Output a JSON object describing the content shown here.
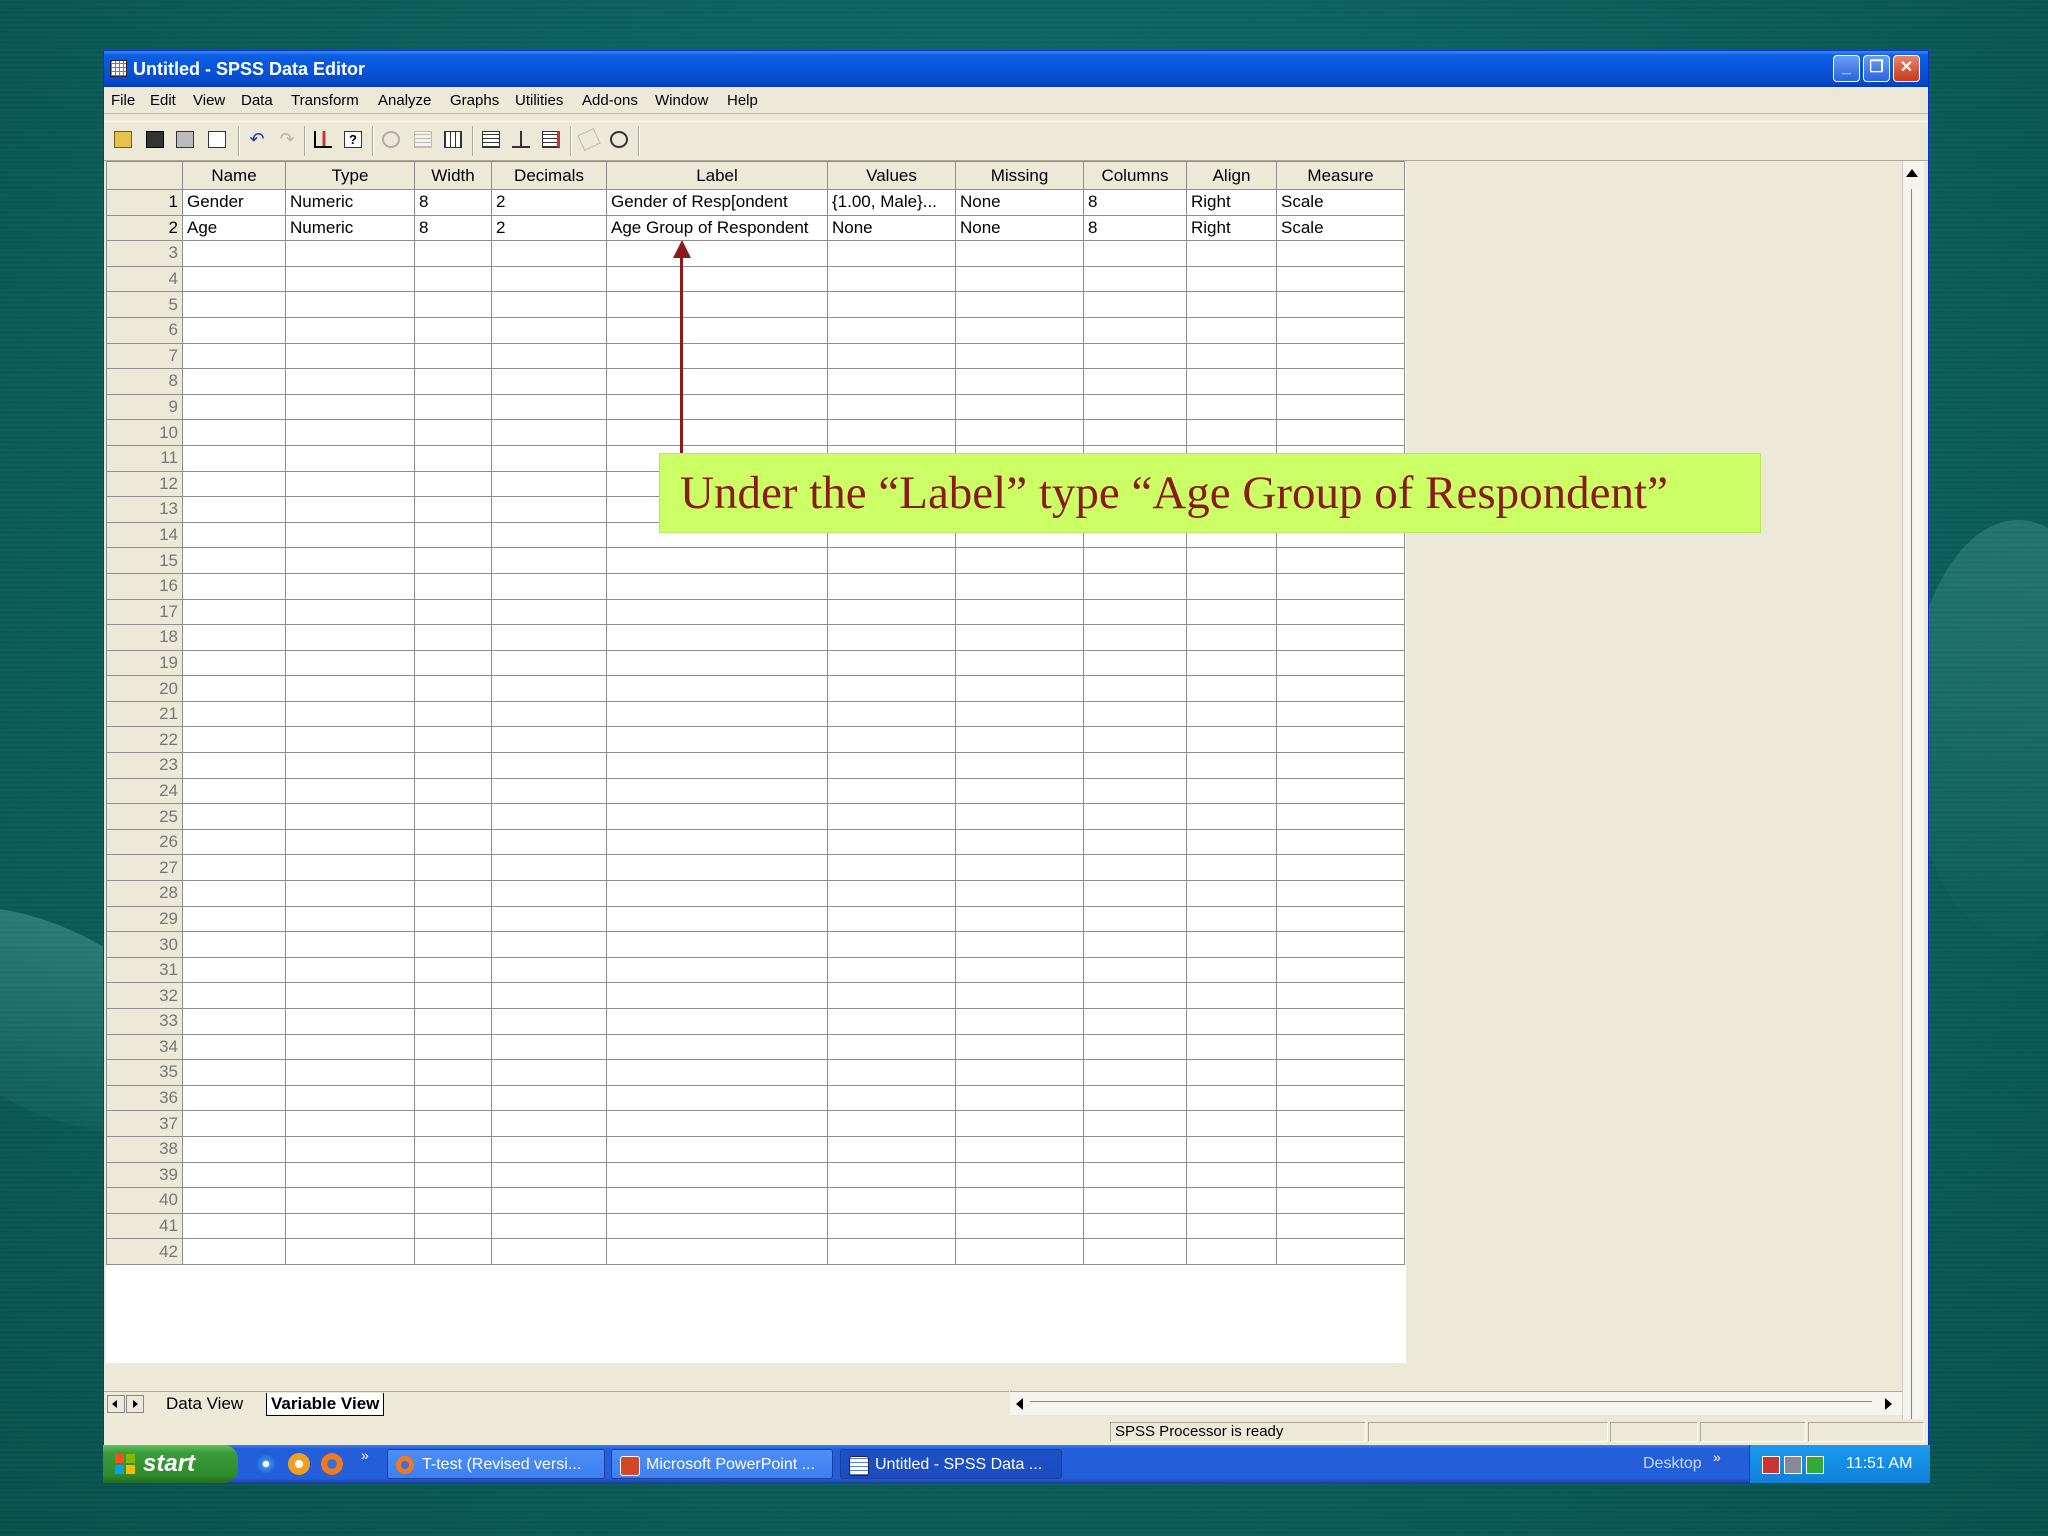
{
  "window": {
    "title": "Untitled - SPSS Data Editor",
    "controls": [
      "minimize",
      "restore",
      "close"
    ]
  },
  "menu": [
    "File",
    "Edit",
    "View",
    "Data",
    "Transform",
    "Analyze",
    "Graphs",
    "Utilities",
    "Add-ons",
    "Window",
    "Help"
  ],
  "toolbar": {
    "icons": [
      "open-icon",
      "save-icon",
      "print-icon",
      "dialog-recall-icon",
      "undo-icon",
      "redo-icon",
      "goto-chart-icon",
      "variables-icon",
      "find-icon",
      "insert-cases-icon",
      "insert-variable-icon",
      "split-file-icon",
      "weight-cases-icon",
      "select-cases-icon",
      "value-labels-icon",
      "use-sets-icon"
    ]
  },
  "grid": {
    "columns": [
      "Name",
      "Type",
      "Width",
      "Decimals",
      "Label",
      "Values",
      "Missing",
      "Columns",
      "Align",
      "Measure"
    ],
    "rows": [
      [
        "Gender",
        "Numeric",
        "8",
        "2",
        "Gender of Resp[ondent",
        "{1.00, Male}...",
        "None",
        "8",
        "Right",
        "Scale"
      ],
      [
        "Age",
        "Numeric",
        "8",
        "2",
        "Age Group of Respondent",
        "None",
        "None",
        "8",
        "Right",
        "Scale"
      ]
    ],
    "row_numbers": [
      "1",
      "2",
      "3",
      "4",
      "5",
      "6",
      "7",
      "8",
      "9",
      "10",
      "11",
      "12",
      "13",
      "14",
      "15",
      "16",
      "17",
      "18",
      "19",
      "20",
      "21",
      "22",
      "23",
      "24",
      "25",
      "26",
      "27",
      "28",
      "29",
      "30",
      "31",
      "32",
      "33",
      "34",
      "35",
      "36",
      "37",
      "38",
      "39",
      "40",
      "41",
      "42"
    ]
  },
  "tabs": {
    "data_view": "Data View",
    "variable_view": "Variable View",
    "active": "Variable View"
  },
  "status": {
    "text": "SPSS Processor  is ready"
  },
  "annotation": {
    "text": "Under the “Label” type “Age Group of Respondent”",
    "color": "#8b1a1a",
    "background": "#ccff66"
  },
  "taskbar": {
    "start": "start",
    "buttons": [
      {
        "label": "T-test (Revised versi...",
        "icon": "firefox-icon"
      },
      {
        "label": "Microsoft PowerPoint ...",
        "icon": "powerpoint-icon"
      },
      {
        "label": "Untitled - SPSS Data ...",
        "icon": "spss-icon",
        "active": true
      }
    ],
    "desktop": "Desktop",
    "clock": "11:51 AM"
  }
}
